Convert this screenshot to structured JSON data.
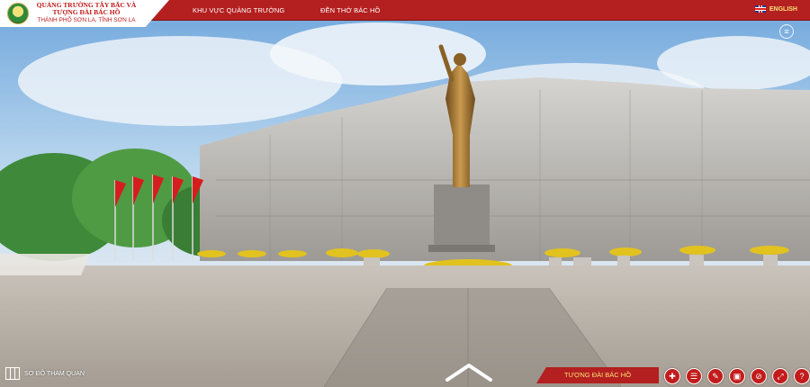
{
  "header": {
    "title": "QUẢNG TRƯỜNG TÂY BẮC VÀ TƯỢNG ĐÀI BÁC HỒ",
    "subtitle": "THÀNH PHỐ SƠN LA, TỈNH SƠN LA",
    "nav": [
      "KHU VỰC QUẢNG TRƯỜNG",
      "ĐỀN THỜ BÁC HỒ"
    ],
    "language_label": "ENGLISH"
  },
  "footer": {
    "map_label": "SƠ ĐỒ THAM QUAN",
    "current_scene": "TƯỢNG ĐÀI BÁC HỒ",
    "tools": [
      "zoom-in-icon",
      "document-icon",
      "edit-icon",
      "gallery-icon",
      "no-audio-icon",
      "fullscreen-icon",
      "help-icon"
    ]
  },
  "colors": {
    "accent_red": "#b41f1f",
    "accent_yellow": "#f7e17a"
  }
}
